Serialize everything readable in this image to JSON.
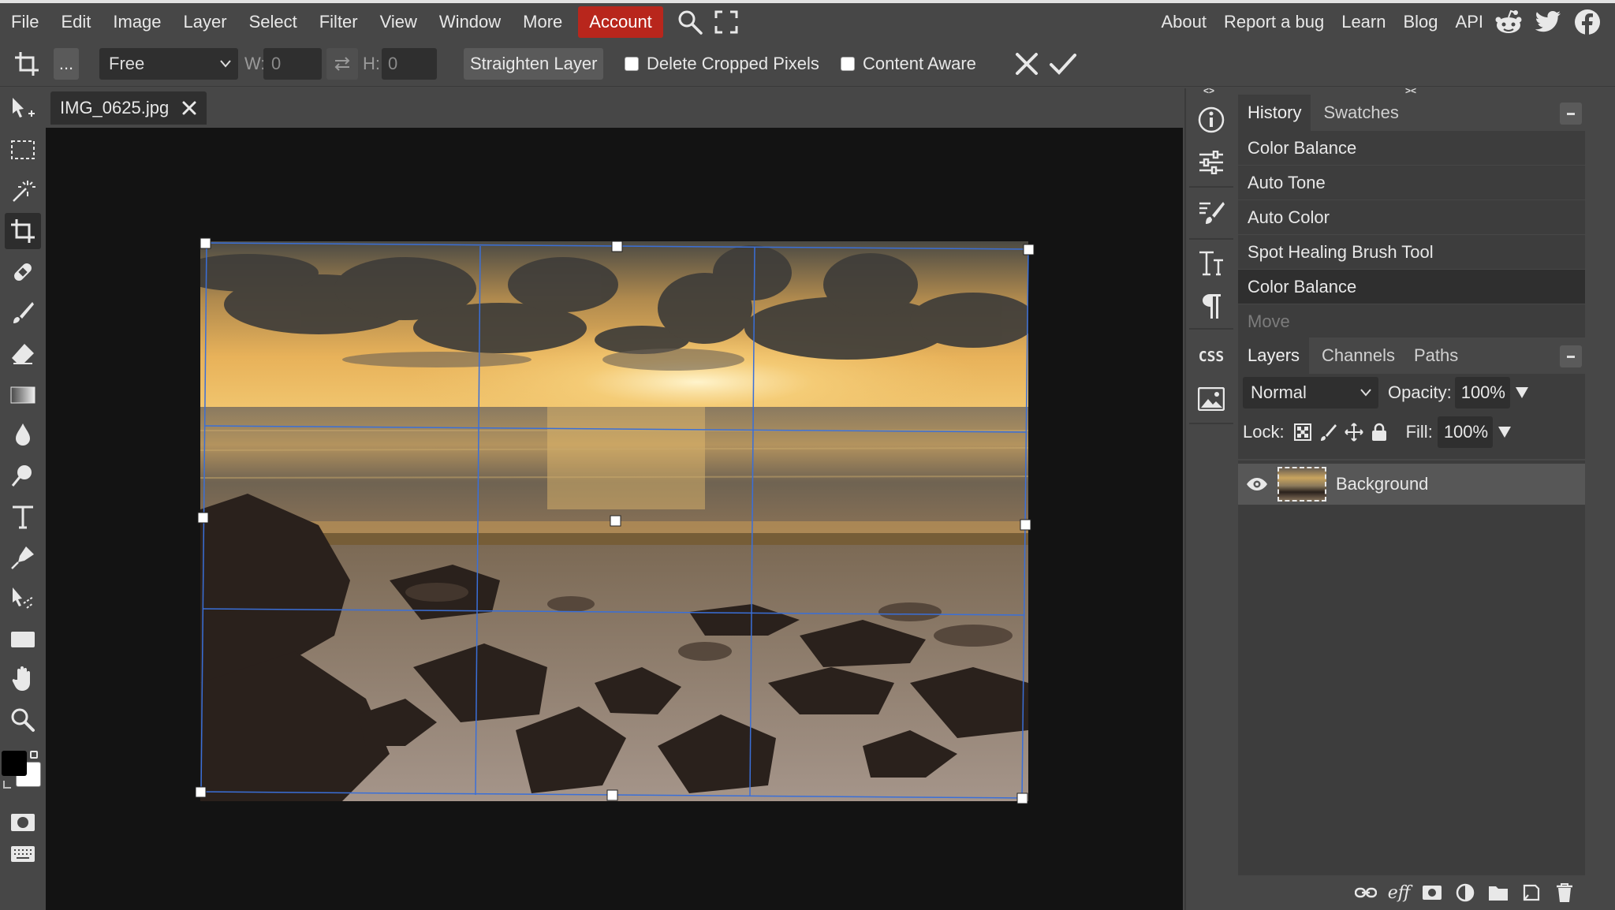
{
  "menu": {
    "items": [
      "File",
      "Edit",
      "Image",
      "Layer",
      "Select",
      "Filter",
      "View",
      "Window",
      "More"
    ],
    "account": "Account",
    "right": [
      "About",
      "Report a bug",
      "Learn",
      "Blog",
      "API"
    ]
  },
  "options": {
    "more_label": "...",
    "mode": "Free",
    "w_label": "W:",
    "w_value": "0",
    "h_label": "H:",
    "h_value": "0",
    "straighten": "Straighten Layer",
    "delete_cropped": "Delete Cropped Pixels",
    "content_aware": "Content Aware"
  },
  "document": {
    "tab_name": "IMG_0625.jpg"
  },
  "panels": {
    "collapse_left": "<>",
    "collapse_right": "><",
    "history_tabs": [
      "History",
      "Swatches"
    ],
    "history_items": [
      "Color Balance",
      "Auto Tone",
      "Auto Color",
      "Spot Healing Brush Tool",
      "Color Balance",
      "Move"
    ],
    "layers_tabs": [
      "Layers",
      "Channels",
      "Paths"
    ],
    "blend_mode": "Normal",
    "opacity_label": "Opacity:",
    "opacity_value": "100%",
    "lock_label": "Lock:",
    "fill_label": "Fill:",
    "fill_value": "100%",
    "layer_name": "Background",
    "css_label": "CSS",
    "eff_label": "eff"
  },
  "colors": {
    "accent": "#b8261c",
    "chrome": "#474747",
    "canvas": "#131313",
    "panel_dark": "#3d3d3d",
    "crop_guide": "#3a6fd8"
  }
}
